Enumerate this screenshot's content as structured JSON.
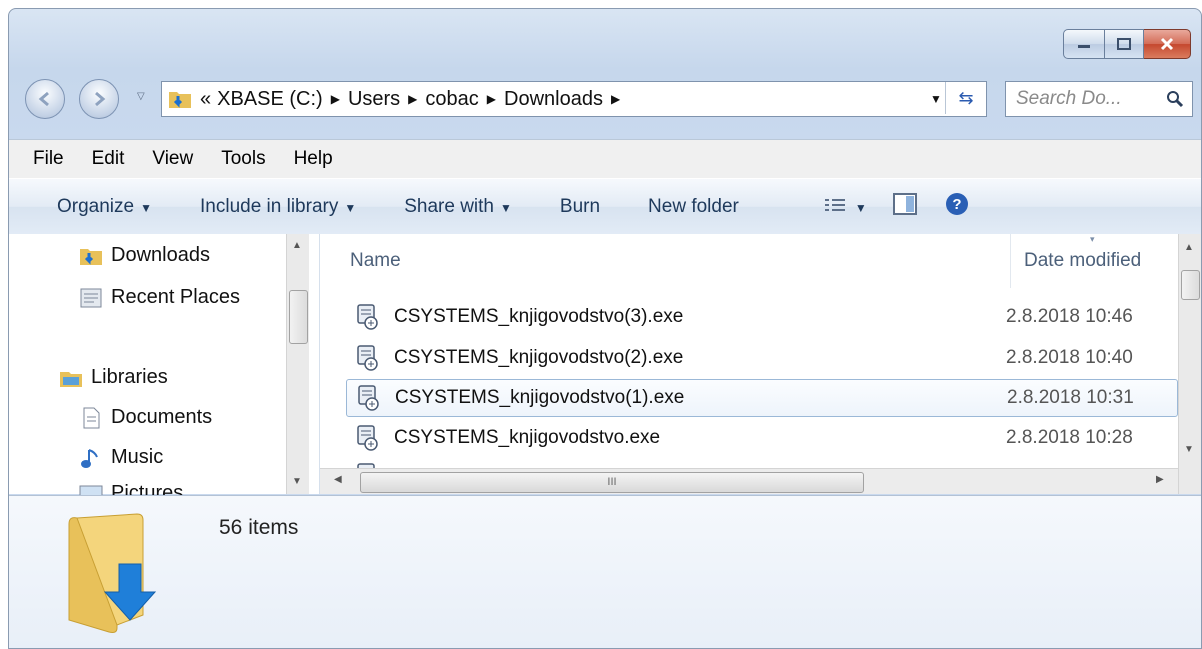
{
  "window": {
    "caption_buttons": [
      "minimize-icon",
      "maximize-icon",
      "close-icon"
    ]
  },
  "address_bar": {
    "overflow": "«",
    "crumbs": [
      "XBASE (C:)",
      "Users",
      "cobac",
      "Downloads"
    ],
    "search_placeholder": "Search Do..."
  },
  "menu": [
    "File",
    "Edit",
    "View",
    "Tools",
    "Help"
  ],
  "toolbar": {
    "organize": "Organize",
    "include": "Include in library",
    "share": "Share with",
    "burn": "Burn",
    "new_folder": "New folder",
    "hscroll_grip": "III"
  },
  "nav": {
    "downloads": "Downloads",
    "recent": "Recent Places",
    "libraries": "Libraries",
    "documents": "Documents",
    "music": "Music",
    "pictures": "Pictures"
  },
  "columns": {
    "name": "Name",
    "date": "Date modified"
  },
  "files": [
    {
      "name": "CSYSTEMS_knjigovodstvo(3).exe",
      "date": "2.8.2018 10:46"
    },
    {
      "name": "CSYSTEMS_knjigovodstvo(2).exe",
      "date": "2.8.2018 10:40"
    },
    {
      "name": "CSYSTEMS_knjigovodstvo(1).exe",
      "date": "2.8.2018 10:31"
    },
    {
      "name": "CSYSTEMS_knjigovodstvo.exe",
      "date": "2.8.2018 10:28"
    }
  ],
  "details": {
    "count": "56 items"
  },
  "colors": {
    "accent": "#2b5bb0",
    "close": "#c5482f",
    "folder": "#e8c15a"
  }
}
